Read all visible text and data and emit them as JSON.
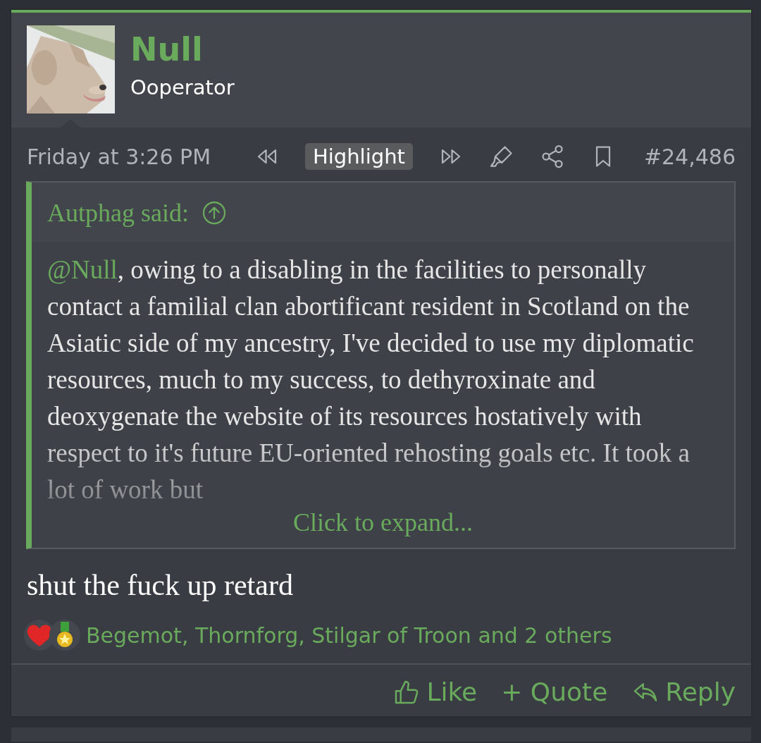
{
  "post": {
    "author": {
      "name": "Null",
      "title": "Ooperator"
    },
    "date": "Friday at 3:26 PM",
    "highlight": "Highlight",
    "number": "#24,486",
    "quote": {
      "attribution": "Autphag said:",
      "mention": "@Null",
      "text": ", owing to a disabling in the facilities to personally contact a familial clan abortificant resident in Scotland on the Asiatic side of my ancestry, I've decided to use my diplomatic resources, much to my success, to dethyroxinate and deoxygenate the website of its resources hostatively with respect to it's future EU-oriented rehosting goals etc. It took a lot of work but",
      "expand": "Click to expand..."
    },
    "message": "shut the fuck up retard",
    "reactions": {
      "icons": [
        {
          "kind": "heart"
        },
        {
          "kind": "medal"
        }
      ],
      "text": "Begemot, Thornforg, Stilgar of Troon and 2 others"
    },
    "actions": [
      {
        "kind": "like",
        "label": "Like"
      },
      {
        "kind": "quote",
        "label": "+ Quote"
      },
      {
        "kind": "reply",
        "label": "Reply"
      }
    ]
  }
}
